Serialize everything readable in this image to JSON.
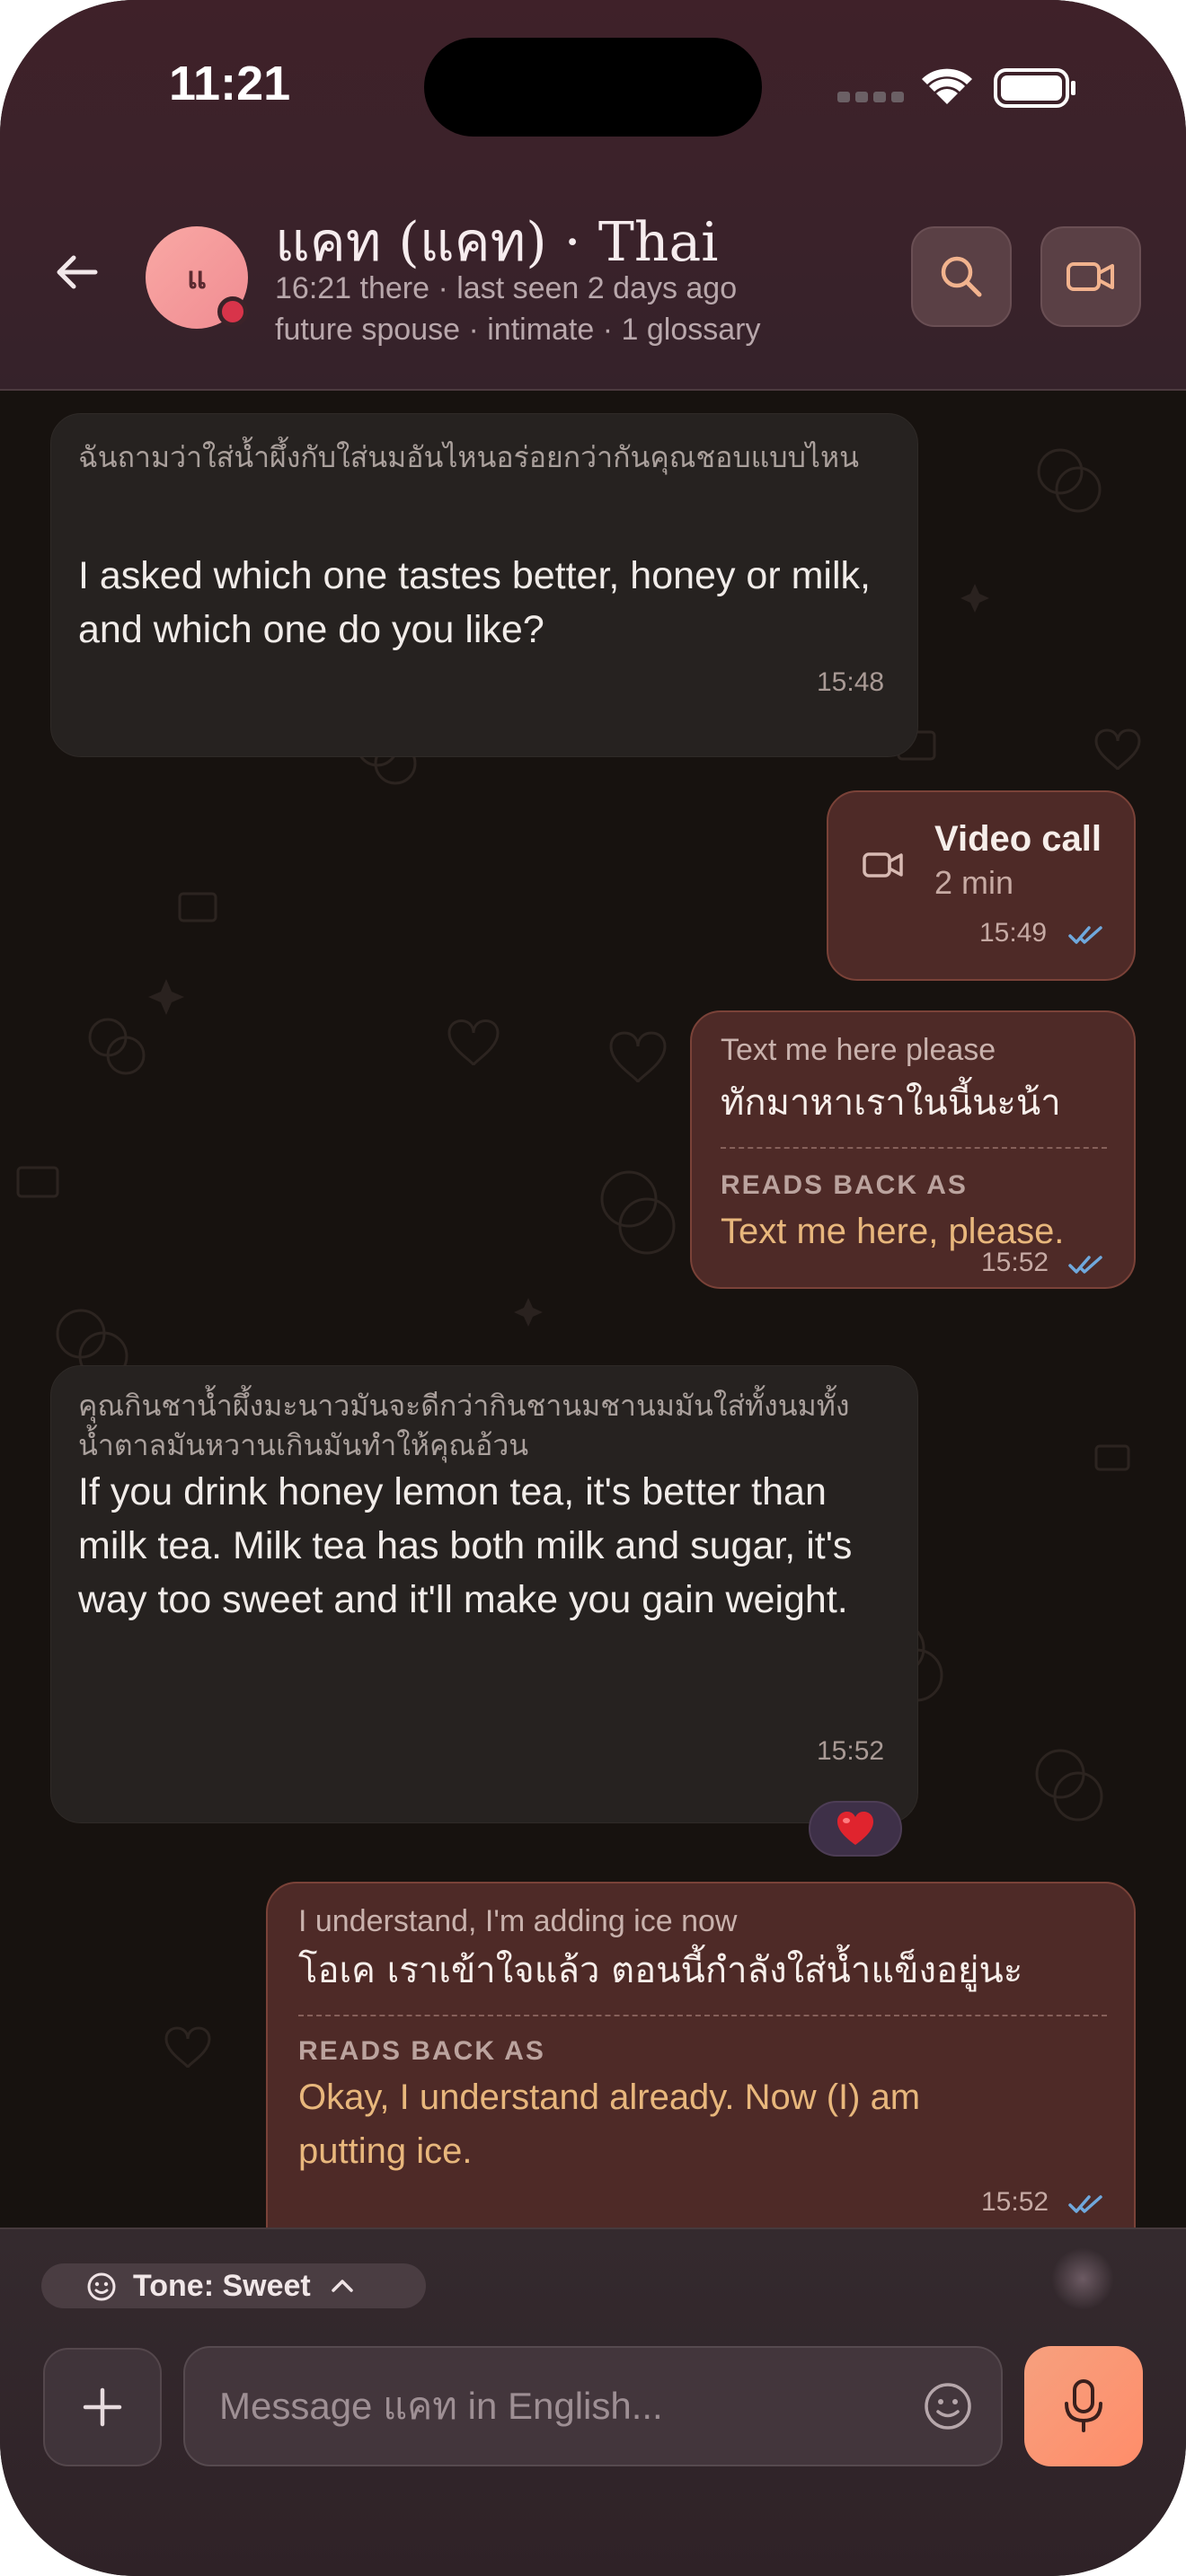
{
  "status_bar": {
    "time": "11:21"
  },
  "header": {
    "back_icon": "arrow-left-icon",
    "avatar_initials": "แ",
    "contact_name": "แคท (แคท) · Thai",
    "subtitle_1": "16:21 there · last seen 2 days ago",
    "subtitle_2": "future spouse · intimate · 1 glossary",
    "search_icon": "search-icon",
    "video_icon": "video-camera-icon"
  },
  "messages": [
    {
      "direction": "incoming",
      "original": "ฉันถามว่าใส่น้ำผึ้งกับใส่นมอันไหนอร่อยกว่ากันคุณชอบแบบไหน",
      "translation": "I asked which one tastes better, honey or milk, and which one do you like?",
      "time": "15:48"
    },
    {
      "direction": "outgoing",
      "kind": "call",
      "title": "Video call",
      "duration": "2 min",
      "time": "15:49",
      "read": true
    },
    {
      "direction": "outgoing",
      "english": "Text me here please",
      "thai": "ทักมาหาเราในนี้นะน้า",
      "reads_back_label": "READS BACK AS",
      "reads_back": "Text me here, please.",
      "time": "15:52",
      "read": true
    },
    {
      "direction": "incoming",
      "original": "คุณกินชาน้ำผึ้งมะนาวมันจะดีกว่ากินชานมชานมมันใส่ทั้งนมทั้งน้ำตาลมันหวานเกินมันทำให้คุณอ้วน",
      "translation": "If you drink honey lemon tea, it's better than milk tea. Milk tea has both milk and sugar, it's way too sweet and it'll make you gain weight.",
      "time": "15:52",
      "reaction": "❤️"
    },
    {
      "direction": "outgoing",
      "english": "I understand, I'm adding ice now",
      "thai": "โอเค เราเข้าใจแล้ว ตอนนี้กำลังใส่น้ำแข็งอยู่นะ",
      "reads_back_label": "READS BACK AS",
      "reads_back": "Okay, I understand already. Now (I) am putting ice.",
      "time": "15:52",
      "read": true
    }
  ],
  "composer": {
    "tone_label": "Tone: Sweet",
    "placeholder": "Message แคท in English...",
    "plus_icon": "plus-icon",
    "emoji_icon": "smiley-icon",
    "mic_icon": "microphone-icon"
  },
  "colors": {
    "header_bg": "#3f2129",
    "chat_bg": "#17120f",
    "incoming_bubble": "#262220",
    "outgoing_bubble": "#4e2a27",
    "reads_back_text": "#e8b77c",
    "read_check": "#6fa8dc",
    "mic_button": "#f6a07e",
    "presence_dot": "#d8344a"
  }
}
